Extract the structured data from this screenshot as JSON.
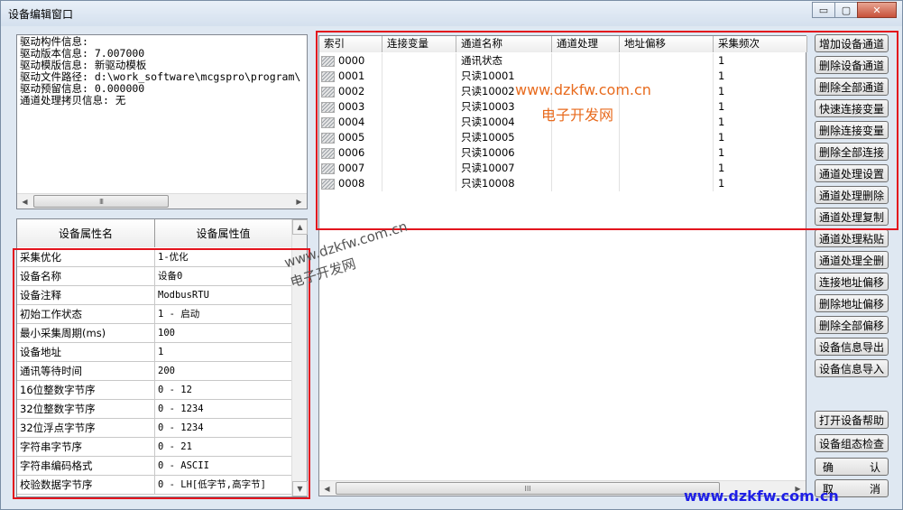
{
  "window": {
    "title": "设备编辑窗口",
    "controls": {
      "minimize": "▭",
      "maximize": "▢",
      "close": "✕"
    }
  },
  "info_lines": [
    "驱动构件信息:",
    "驱动版本信息: 7.007000",
    "驱动模版信息: 新驱动模板",
    "驱动文件路径: d:\\work_software\\mcgspro\\program\\",
    "驱动预留信息: 0.000000",
    "通道处理拷贝信息: 无"
  ],
  "properties": {
    "headers": [
      "设备属性名",
      "设备属性值"
    ],
    "rows": [
      [
        "采集优化",
        "1-优化"
      ],
      [
        "设备名称",
        "设备0"
      ],
      [
        "设备注释",
        "ModbusRTU"
      ],
      [
        "初始工作状态",
        "1 - 启动"
      ],
      [
        "最小采集周期(ms)",
        "100"
      ],
      [
        "设备地址",
        "1"
      ],
      [
        "通讯等待时间",
        "200"
      ],
      [
        "16位整数字节序",
        "0 - 12"
      ],
      [
        "32位整数字节序",
        "0 - 1234"
      ],
      [
        "32位浮点字节序",
        "0 - 1234"
      ],
      [
        "字符串字节序",
        "0 - 21"
      ],
      [
        "字符串编码格式",
        "0 - ASCII"
      ],
      [
        "校验数据字节序",
        "0 - LH[低字节,高字节]"
      ]
    ]
  },
  "channels": {
    "headers": [
      "索引",
      "连接变量",
      "通道名称",
      "通道处理",
      "地址偏移",
      "采集频次"
    ],
    "rows": [
      [
        "0000",
        "",
        "通讯状态",
        "",
        "",
        "1"
      ],
      [
        "0001",
        "",
        "只读10001",
        "",
        "",
        "1"
      ],
      [
        "0002",
        "",
        "只读10002",
        "",
        "",
        "1"
      ],
      [
        "0003",
        "",
        "只读10003",
        "",
        "",
        "1"
      ],
      [
        "0004",
        "",
        "只读10004",
        "",
        "",
        "1"
      ],
      [
        "0005",
        "",
        "只读10005",
        "",
        "",
        "1"
      ],
      [
        "0006",
        "",
        "只读10006",
        "",
        "",
        "1"
      ],
      [
        "0007",
        "",
        "只读10007",
        "",
        "",
        "1"
      ],
      [
        "0008",
        "",
        "只读10008",
        "",
        "",
        "1"
      ]
    ]
  },
  "buttons": [
    "增加设备通道",
    "删除设备通道",
    "删除全部通道",
    "快速连接变量",
    "删除连接变量",
    "删除全部连接",
    "通道处理设置",
    "通道处理删除",
    "通道处理复制",
    "通道处理粘贴",
    "通道处理全删",
    "连接地址偏移",
    "删除地址偏移",
    "删除全部偏移",
    "设备信息导出",
    "设备信息导入",
    "打开设备帮助",
    "设备组态检查"
  ],
  "confirm_button": {
    "left": "确",
    "right": "认"
  },
  "cancel_button": {
    "left": "取",
    "right": "消"
  },
  "scroll": {
    "left": "◀",
    "right": "▶",
    "up": "▲",
    "down": "▼",
    "grip": "III"
  },
  "watermarks": {
    "url": "www.dzkfw.com.cn",
    "name": "电子开发网"
  },
  "colors": {
    "annotation_red": "#e3141d",
    "watermark_orange": "#e86b1e",
    "watermark_blue": "#1f1fe6"
  }
}
